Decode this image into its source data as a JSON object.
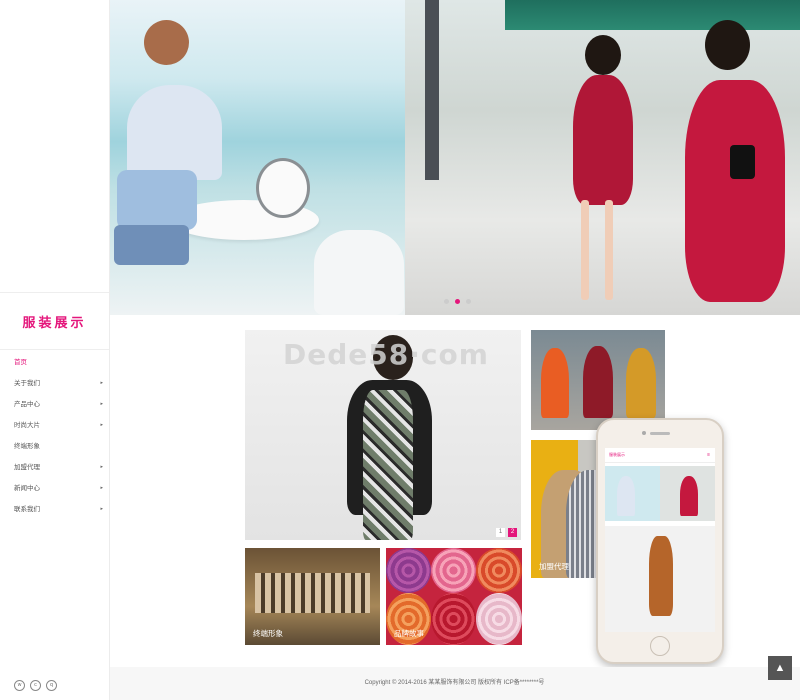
{
  "brand": {
    "logo_text": "服装展示"
  },
  "nav": {
    "items": [
      {
        "label": "首页",
        "has_sub": false,
        "active": true
      },
      {
        "label": "关于我们",
        "has_sub": true,
        "active": false
      },
      {
        "label": "产品中心",
        "has_sub": true,
        "active": false
      },
      {
        "label": "时尚大片",
        "has_sub": true,
        "active": false
      },
      {
        "label": "终端形象",
        "has_sub": false,
        "active": false
      },
      {
        "label": "加盟代理",
        "has_sub": true,
        "active": false
      },
      {
        "label": "新闻中心",
        "has_sub": true,
        "active": false
      },
      {
        "label": "联系我们",
        "has_sub": true,
        "active": false
      }
    ],
    "arrow_glyph": "▸"
  },
  "hero": {
    "slides": 3,
    "active_slide": 2
  },
  "grid": {
    "watermark": "Dede58·com",
    "pager": [
      "1",
      "2"
    ],
    "pager_active": "2",
    "captions": {
      "store": "终端形象",
      "fabric": "品牌故事",
      "franchise": "加盟代理"
    }
  },
  "phone": {
    "screen_title": "服装展示",
    "menu_glyph": "≡"
  },
  "footer": {
    "copyright": "Copyright © 2014-2016 某某服饰有限公司 版权所有    ICP备********号"
  },
  "icons": {
    "to_top": "arrow-up-icon",
    "social": [
      "weibo-icon",
      "wechat-icon",
      "qq-icon"
    ]
  },
  "colors": {
    "accent": "#e4167b",
    "footer_bg": "#f7f7f7"
  }
}
